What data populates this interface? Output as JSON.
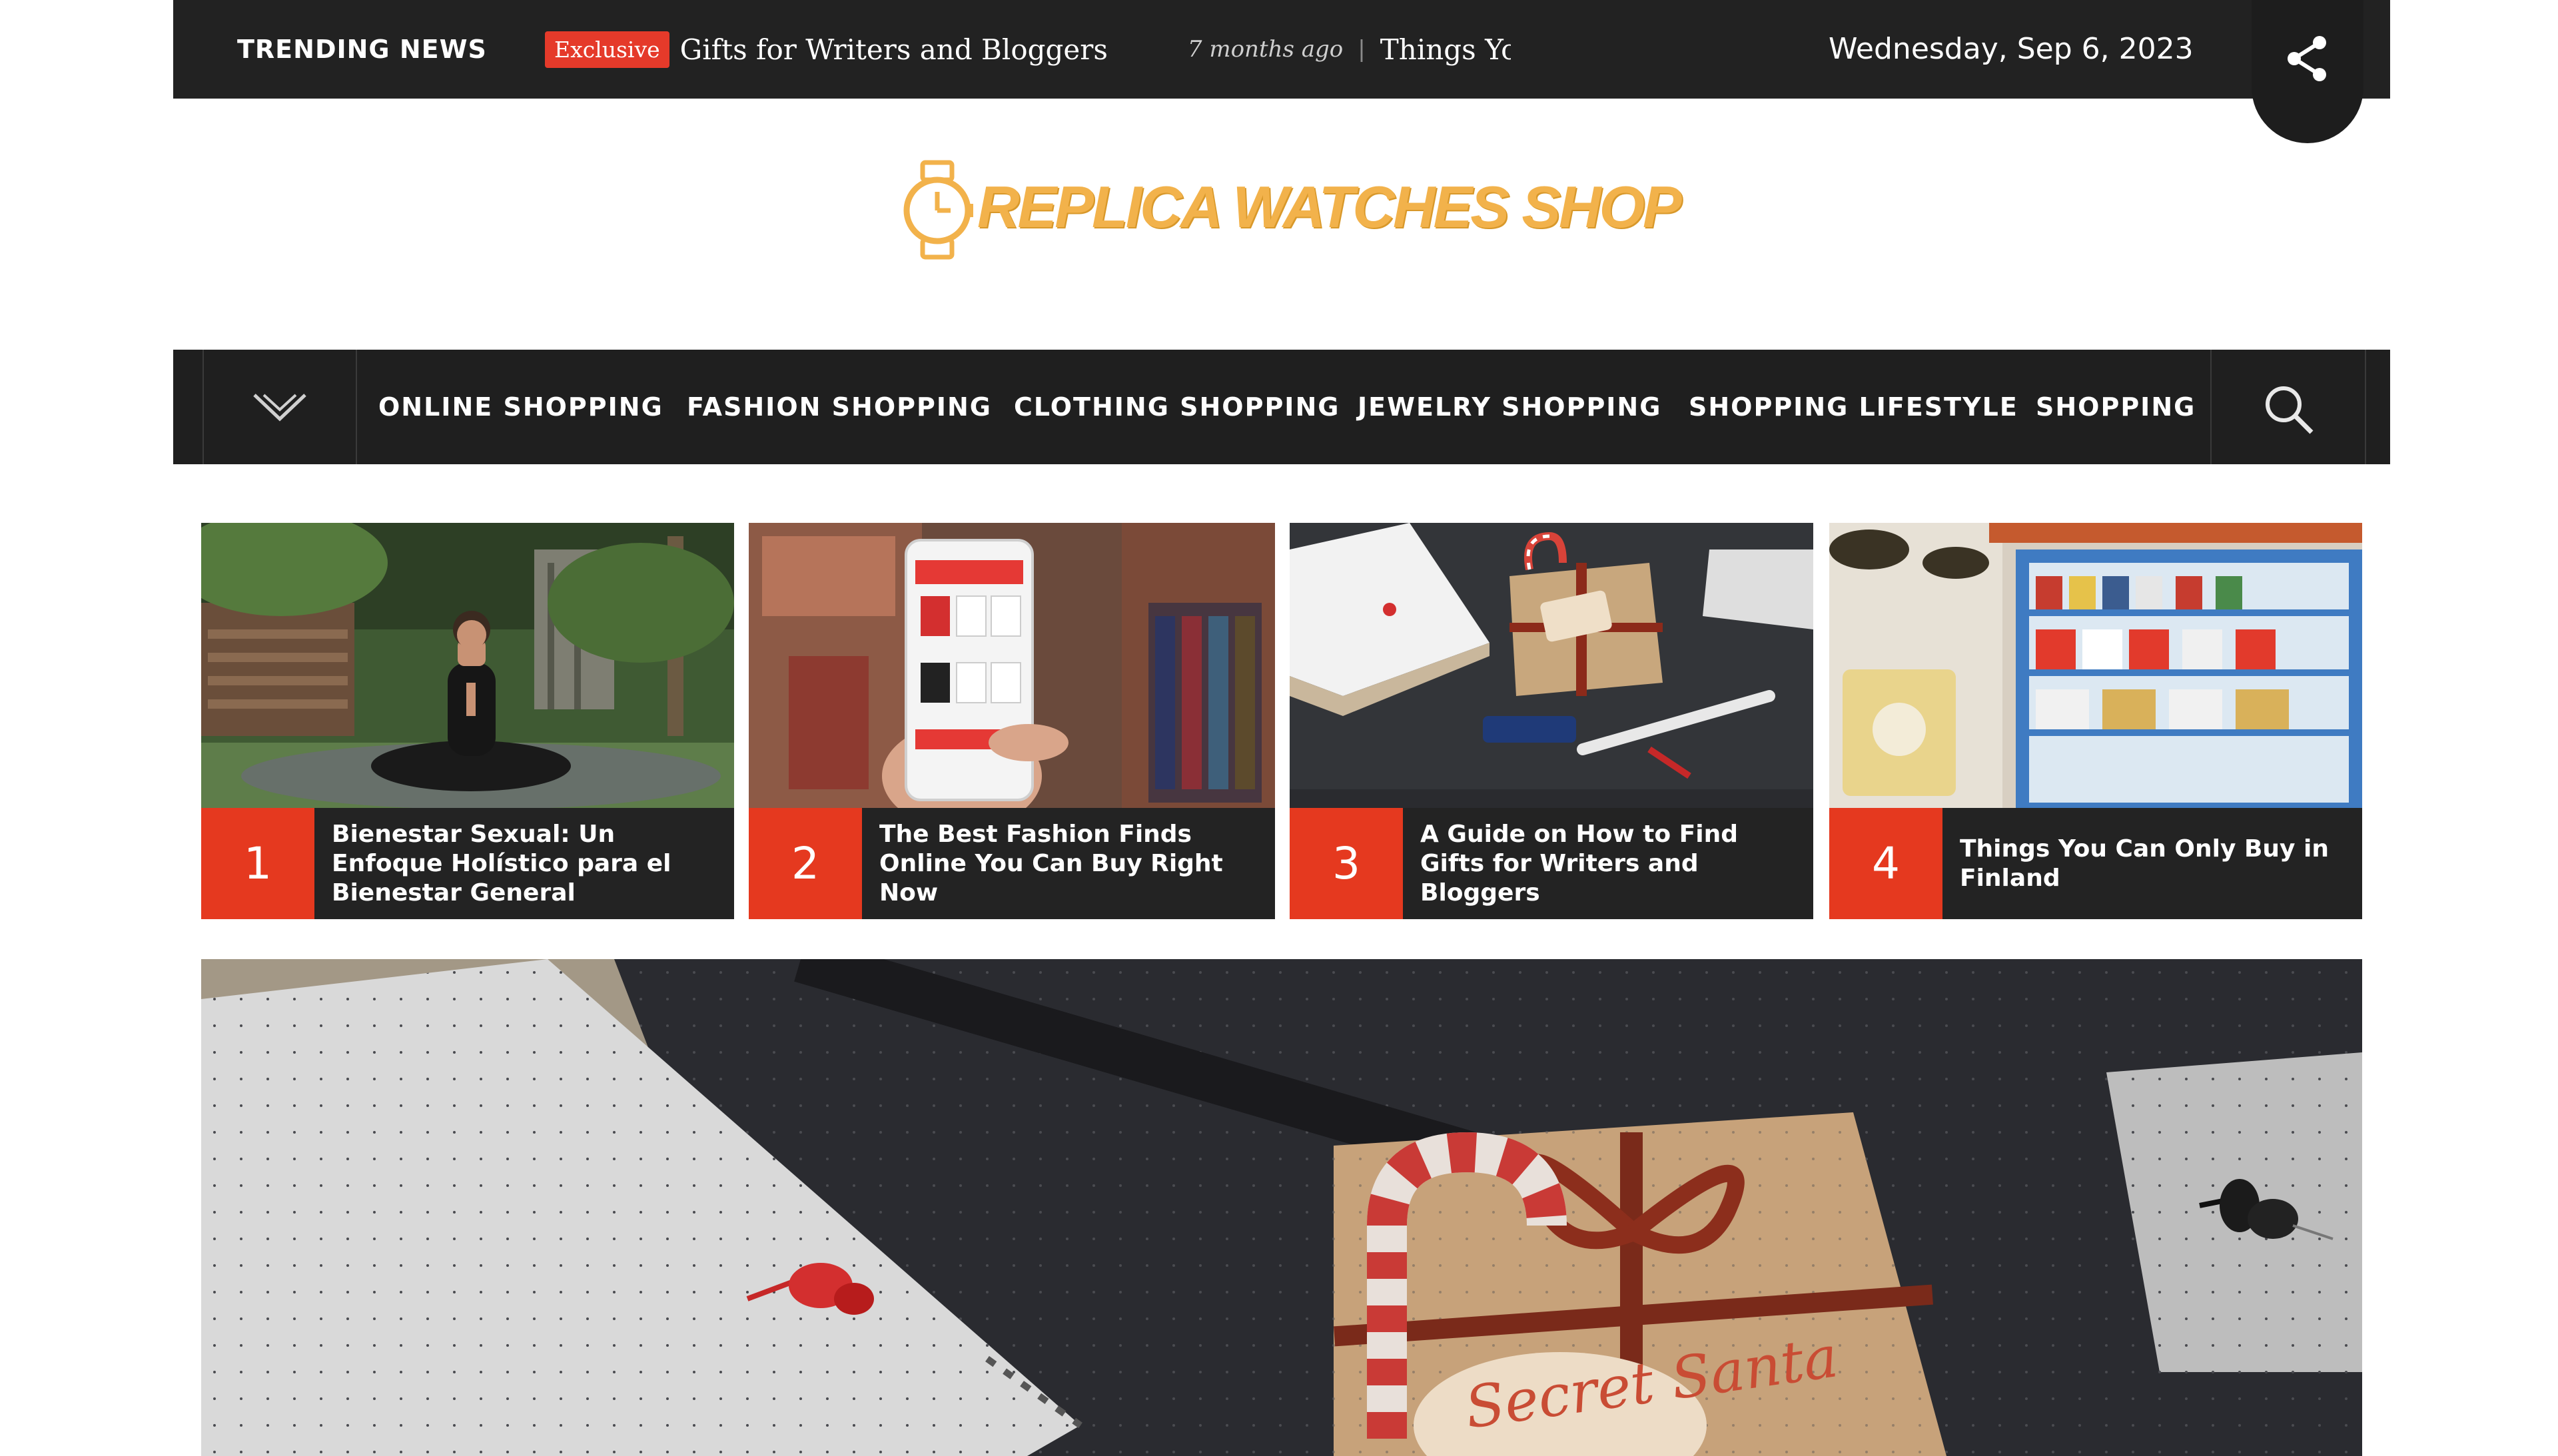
{
  "topbar": {
    "trending_label": "TRENDING NEWS",
    "ticker": [
      {
        "badge": "Exclusive",
        "title": "Gifts for Writers and Bloggers"
      },
      {
        "time": "7 months ago",
        "title": "Things You Can Only Buy in Finland"
      }
    ],
    "date": "Wednesday, Sep 6, 2023",
    "share_icon": "share-icon"
  },
  "logo": {
    "text": "REPLICA WATCHES SHOP",
    "icon": "watch-icon"
  },
  "nav": {
    "toggle_icon": "chevron-down-icon",
    "items": [
      {
        "label": "ONLINE SHOPPING"
      },
      {
        "label": "FASHION SHOPPING"
      },
      {
        "label": "CLOTHING SHOPPING"
      },
      {
        "label": "JEWELRY SHOPPING"
      },
      {
        "label": "SHOPPING LIFESTYLE"
      },
      {
        "label": "SHOPPING"
      }
    ],
    "search_icon": "search-icon"
  },
  "cards": [
    {
      "num": "1",
      "title": "Bienestar Sexual: Un Enfoque Holístico para el Bienestar General"
    },
    {
      "num": "2",
      "title": "The Best Fashion Finds Online You Can Buy Right Now"
    },
    {
      "num": "3",
      "title": "A Guide on How to Find Gifts for Writers and Bloggers"
    },
    {
      "num": "4",
      "title": "Things You Can Only Buy in Finland"
    }
  ],
  "hero": {
    "tag_text": "Secret Santa"
  },
  "colors": {
    "accent": "#e5391f",
    "dark": "#222222",
    "logo": "#f2b24b"
  }
}
